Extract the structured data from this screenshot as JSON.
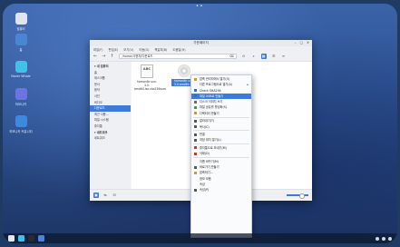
{
  "desktop": {
    "icons": [
      {
        "label": "컴퓨터",
        "icon": "computer-icon",
        "color": "#dfe5ee"
      },
      {
        "label": "홈",
        "icon": "home-folder-icon",
        "color": "#4a86d6"
      },
      {
        "label": "Naver Whale",
        "icon": "whale-browser-icon",
        "color": "#3fc2e8"
      },
      {
        "label": "하모니카",
        "icon": "hamonikr-icon",
        "color": "#6b74e0"
      },
      {
        "label": "하모니카 커뮤니티",
        "icon": "community-icon",
        "color": "#3d89dd"
      }
    ]
  },
  "window": {
    "title": "가운페이지",
    "controls": [
      "–",
      "□",
      "✕"
    ],
    "menu": [
      "파일(F)",
      "편집(E)",
      "보기(V)",
      "이동(G)",
      "책갈피(B)",
      "도움말(H)"
    ],
    "location": "/home/사용자/다운로드"
  },
  "sidebar": {
    "items": [
      {
        "label": "▾ 내 컴퓨터",
        "head": true
      },
      {
        "label": "홈"
      },
      {
        "label": "데스크톱"
      },
      {
        "label": "문서"
      },
      {
        "label": "음악"
      },
      {
        "label": "사진"
      },
      {
        "label": "비디오"
      },
      {
        "label": "다운로드",
        "selected": true
      },
      {
        "label": "최근 사용..."
      },
      {
        "label": "파일 시스템"
      },
      {
        "label": "휴지통"
      },
      {
        "label": "▾ 네트워크",
        "head": true
      },
      {
        "label": "네트워크"
      }
    ]
  },
  "files": [
    {
      "name": "hamonikr-sun-3.0-amd64.iso.sha256sum",
      "thumb": "ABC",
      "kind": "text"
    },
    {
      "name": "hamonikr-sun-3.0-amd64.iso",
      "kind": "disc",
      "selected": true
    }
  ],
  "context_menu": {
    "items": [
      {
        "label": "압축 관리자에서 열기(O)",
        "icon": "archive-icon",
        "color": "#c79a3b"
      },
      {
        "label": "다른 프로그램으로 열기(A)",
        "submenu": true
      },
      {
        "label": "Check SHA256",
        "icon": "check-icon",
        "color": "#2f6fd0"
      },
      {
        "label": "파일 USB로 만들기",
        "icon": "usb-icon",
        "color": "#2f6fd0",
        "highlighted": true
      },
      {
        "label": "디스크 이미지 쓰기",
        "icon": "disk-icon",
        "color": "#6a6a6a"
      },
      {
        "label": "파일 공유를 활성화(S)",
        "icon": "share-icon",
        "color": "#3a9a4a"
      },
      {
        "label": "디렉터리 만들기",
        "icon": "folder-icon",
        "color": "#c79a3b"
      },
      {
        "sep": true
      },
      {
        "label": "잘라내기(T)",
        "icon": "cut-icon",
        "color": "#555"
      },
      {
        "label": "복사(C)",
        "icon": "copy-icon",
        "color": "#555"
      },
      {
        "sep": true
      },
      {
        "label": "연결",
        "icon": "link-icon",
        "color": "#555"
      },
      {
        "label": "저장 위치 열기(L)",
        "icon": "open-icon",
        "color": "#555"
      },
      {
        "sep": true
      },
      {
        "label": "휴지통으로 보내기(M)",
        "icon": "trash-icon",
        "color": "#c0392b"
      },
      {
        "label": "삭제(D)",
        "icon": "delete-icon",
        "color": "#c0392b"
      },
      {
        "sep": true
      },
      {
        "label": "이름 바꾸기(M)"
      },
      {
        "label": "바로가기 만들기",
        "icon": "shortcut-icon",
        "color": "#555"
      },
      {
        "label": "압축하기...",
        "icon": "compress-icon",
        "color": "#c79a3b"
      },
      {
        "label": "정보 모음"
      },
      {
        "label": "속성"
      },
      {
        "label": "속성(P)",
        "icon": "properties-icon",
        "color": "#555"
      }
    ]
  },
  "taskbar": {
    "apps": [
      {
        "icon": "menu-icon",
        "color": "#e8e8e8"
      },
      {
        "icon": "whale-icon",
        "color": "#3fc2e8"
      },
      {
        "icon": "terminal-icon",
        "color": "#2b2b2b"
      },
      {
        "icon": "files-icon",
        "color": "#4a86d6"
      }
    ]
  }
}
